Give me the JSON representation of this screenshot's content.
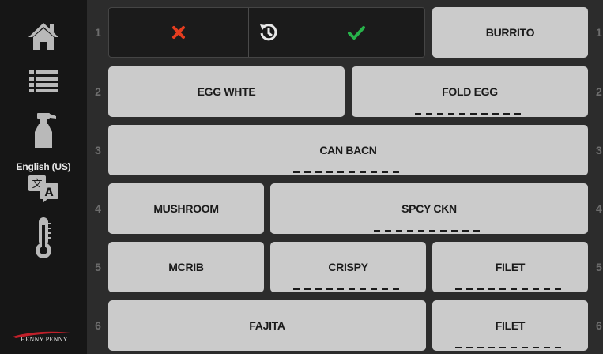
{
  "sidebar": {
    "language_label": "English (US)",
    "brand": "HENNY PENNY",
    "icons": [
      "home-icon",
      "menu-list-icon",
      "spray-bottle-icon",
      "translate-icon",
      "thermometer-icon"
    ]
  },
  "control_bar": {
    "icons": [
      "cancel-x-icon",
      "history-icon",
      "confirm-check-icon"
    ],
    "colors": {
      "cancel": "#e53d1f",
      "confirm": "#27b24a"
    }
  },
  "rows": [
    {
      "number": "1",
      "keys": [
        "BURRITO"
      ]
    },
    {
      "number": "2",
      "keys": [
        "EGG WHTE",
        "FOLD EGG"
      ]
    },
    {
      "number": "3",
      "keys": [
        "CAN BACN"
      ]
    },
    {
      "number": "4",
      "keys": [
        "MUSHROOM",
        "SPCY CKN"
      ]
    },
    {
      "number": "5",
      "keys": [
        "MCRIB",
        "CRISPY",
        "FILET"
      ]
    },
    {
      "number": "6",
      "keys": [
        "FAJITA",
        "FILET"
      ]
    }
  ],
  "colors": {
    "key_bg": "#cbcbcb",
    "panel_bg": "#2c2c2c",
    "sidebar_bg": "#161616"
  }
}
